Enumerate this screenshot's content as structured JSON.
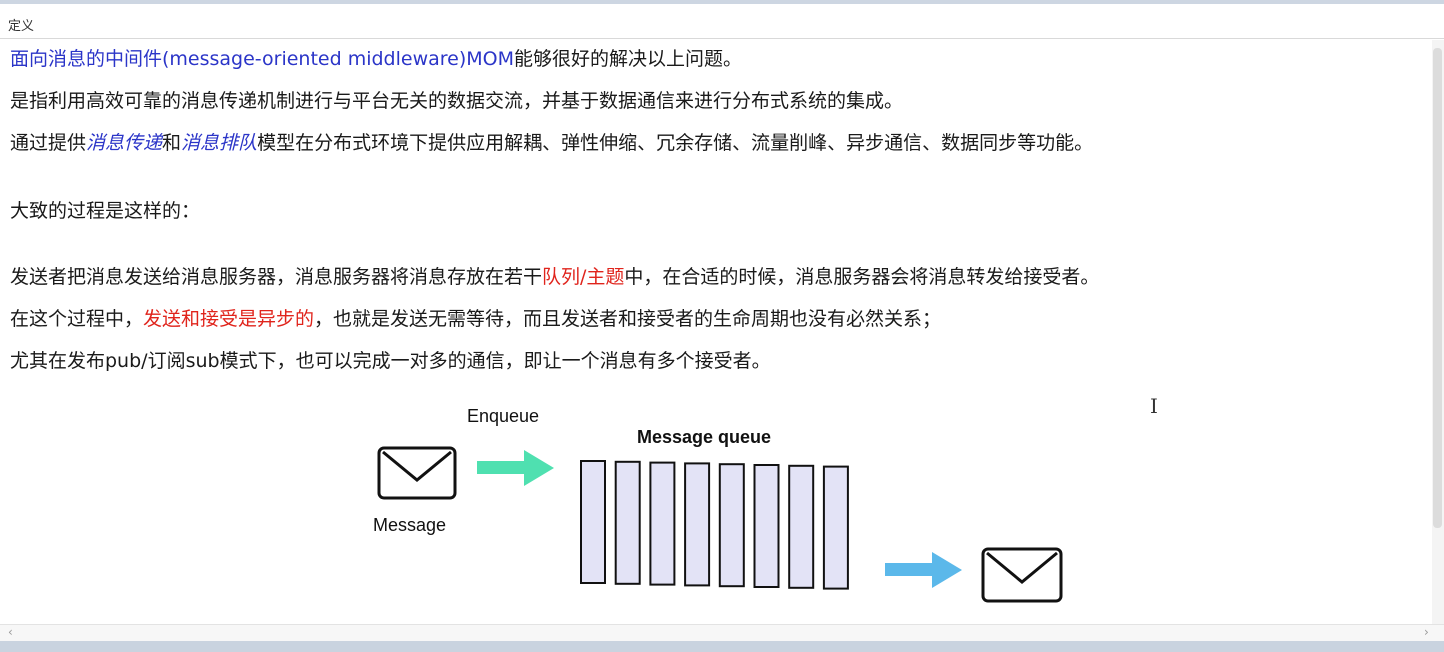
{
  "window": {
    "title": "定义"
  },
  "paragraphs": {
    "p1": {
      "blue": "面向消息的中间件(message-oriented middleware)MOM",
      "rest": "能够很好的解决以上问题。"
    },
    "p2": {
      "text": " 是指利用高效可靠的消息传递机制进行与平台无关的数据交流，并基于数据通信来进行分布式系统的集成。"
    },
    "p3": {
      "pre": "通过提供",
      "em1": "消息传递",
      "mid": "和",
      "em2": "消息排队",
      "post": "模型在分布式环境下提供应用解耦、弹性伸缩、冗余存储、流量削峰、异步通信、数据同步等功能。"
    },
    "p4": {
      "text": "大致的过程是这样的："
    },
    "p5": {
      "pre": "发送者把消息发送给消息服务器，消息服务器将消息存放在若干",
      "red": "队列/主题",
      "post": "中，在合适的时候，消息服务器会将消息转发给接受者。"
    },
    "p6": {
      "pre": "在这个过程中，",
      "red": "发送和接受是异步的",
      "post": "，也就是发送无需等待，而且发送者和接受者的生命周期也没有必然关系；"
    },
    "p7": {
      "text": "尤其在发布pub/订阅sub模式下，也可以完成一对多的通信，即让一个消息有多个接受者。"
    }
  },
  "diagram": {
    "enqueue_label": "Enqueue",
    "queue_label": "Message queue",
    "message_label": "Message",
    "queue_slots": 8,
    "colors": {
      "enqueue_arrow": "#4fe0b0",
      "dequeue_arrow": "#5bb8ea",
      "slot_fill": "#e3e3f6",
      "stroke": "#111111"
    },
    "icons": [
      "envelope-icon",
      "enqueue-arrow-icon",
      "dequeue-arrow-icon",
      "envelope-icon"
    ]
  },
  "scrollbar": {
    "left_arrow": "‹",
    "right_arrow": "›"
  }
}
